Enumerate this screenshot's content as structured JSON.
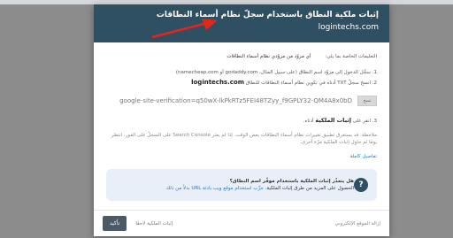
{
  "dialog": {
    "title": "إثبات ملكية النطاق باستخدام سجلّ نظام أسماء النطاقات",
    "subtitle": "logintechs.com"
  },
  "body": {
    "instructions_label": "التعليمات الخاصة بما يلي:",
    "provider_select": "أي مزوّد من مزوّدي نظام أسماء النطاقات",
    "step1": "1. سجِّل الدخول إلى مزوّد اسم النطاق (على سبيل المثال، godaddy.com أو namecheap.com)",
    "step2_prefix": "2. انسخ سجلّ TXT أدناه في تكوين نظام أسماء النطاقات للنطاق",
    "step2_domain": "logintechs.com",
    "verification_code": "google-site-verification=q50wX-lkPkRTz5FEI48TZyy_f9GPLY32-QM4A8x0bD",
    "copy_label": "نسخ",
    "step3_prefix": "3. انقر على",
    "step3_bold": "إثبات الملكية",
    "step3_suffix": "أدناه.",
    "note": "ملاحظة: قد يستغرق تطبيق تغييرات نظام أسماء النطاقات بعض الوقت. إذا لم يعثر Search Console على السجلّ على الفور، انتظر يومًا ثم حاوِل إثبات الملكية مرّة أخرى.",
    "details_link": "تفاصيل كاملة"
  },
  "help": {
    "question": "هل يتعذّر إثبات الملكية باستخدام موفّر اسم النطاق؟",
    "text": "الحصول على المزيد من طرق إثبات الملكية.",
    "link": "جرِّب استخدام موقع ويب بادئة URL بدلاً من ذلك",
    "icon": "question-icon"
  },
  "footer": {
    "remove": "إزالة الموقع الإلكتروني",
    "later": "إثبات الملكية لاحقًا",
    "ok": "تأكيد"
  }
}
